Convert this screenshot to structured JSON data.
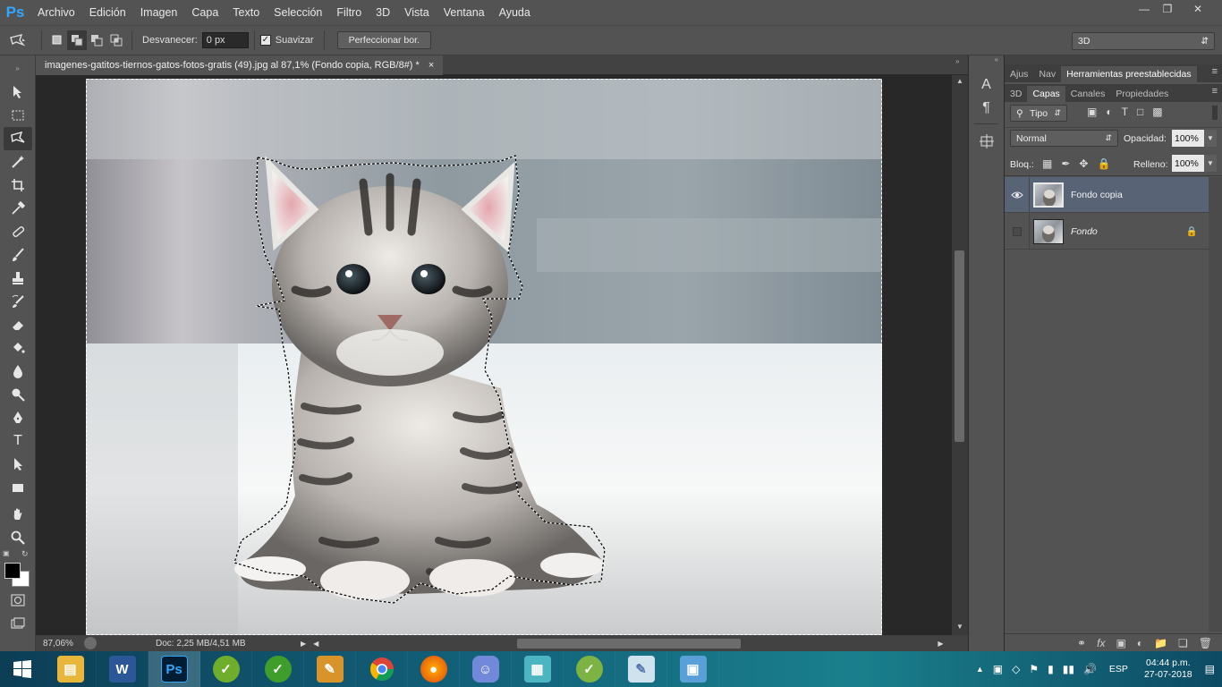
{
  "app": {
    "logo": "Ps"
  },
  "menu": [
    "Archivo",
    "Edición",
    "Imagen",
    "Capa",
    "Texto",
    "Selección",
    "Filtro",
    "3D",
    "Vista",
    "Ventana",
    "Ayuda"
  ],
  "options": {
    "feather_label": "Desvanecer:",
    "feather_value": "0 px",
    "antialias_label": "Suavizar",
    "refine_button": "Perfeccionar bor.",
    "workspace": "3D"
  },
  "document": {
    "tab_title": "imagenes-gatitos-tiernos-gatos-fotos-gratis (49).jpg al 87,1% (Fondo copia, RGB/8#) *",
    "close": "×"
  },
  "status": {
    "zoom": "87,06%",
    "doc_size": "Doc: 2,25 MB/4,51 MB"
  },
  "panel_top_tabs": [
    "Ajus",
    "Nav",
    "Herramientas preestablecidas"
  ],
  "panel_tabs": [
    "3D",
    "Capas",
    "Canales",
    "Propiedades"
  ],
  "layers_panel": {
    "filter_kind": "Tipo",
    "blend_mode": "Normal",
    "opacity_label": "Opacidad:",
    "opacity_value": "100%",
    "lock_label": "Bloq.:",
    "fill_label": "Relleno:",
    "fill_value": "100%",
    "layers": [
      {
        "name": "Fondo copia",
        "visible": true,
        "selected": true,
        "locked": false
      },
      {
        "name": "Fondo",
        "visible": false,
        "selected": false,
        "locked": true
      }
    ]
  },
  "taskbar": {
    "language": "ESP",
    "time": "04:44 p.m.",
    "date": "27-07-2018",
    "apps": [
      "explorer",
      "word",
      "photoshop",
      "app-green-1",
      "app-green-2",
      "app-paint",
      "chrome",
      "firefox",
      "discord",
      "app-cubes",
      "app-green-3",
      "app-notes",
      "app-image"
    ]
  },
  "colors": {
    "accent": "#31a8ff",
    "panel": "#535353",
    "dark": "#282828",
    "selected_layer": "#586375"
  }
}
